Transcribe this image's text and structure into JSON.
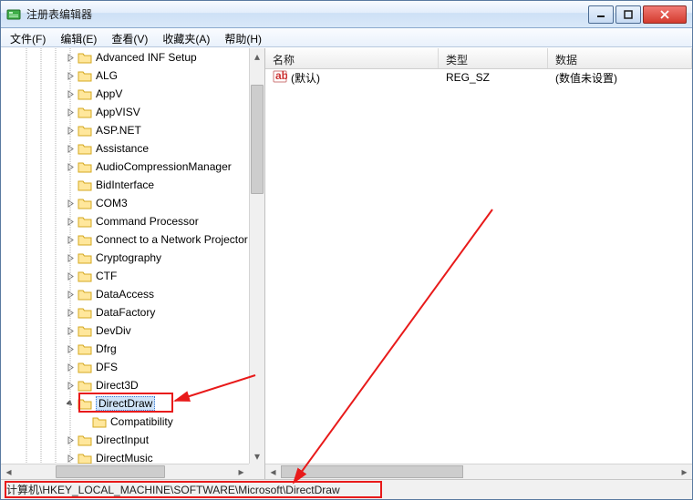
{
  "window": {
    "title": "注册表编辑器"
  },
  "menu": {
    "file": "文件(F)",
    "edit": "编辑(E)",
    "view": "查看(V)",
    "favorites": "收藏夹(A)",
    "help": "帮助(H)"
  },
  "tree": {
    "items": [
      {
        "indent": 4,
        "exp": "closed",
        "label": "Advanced INF Setup"
      },
      {
        "indent": 4,
        "exp": "closed",
        "label": "ALG"
      },
      {
        "indent": 4,
        "exp": "closed",
        "label": "AppV"
      },
      {
        "indent": 4,
        "exp": "closed",
        "label": "AppVISV"
      },
      {
        "indent": 4,
        "exp": "closed",
        "label": "ASP.NET"
      },
      {
        "indent": 4,
        "exp": "closed",
        "label": "Assistance"
      },
      {
        "indent": 4,
        "exp": "closed",
        "label": "AudioCompressionManager"
      },
      {
        "indent": 4,
        "exp": "none",
        "label": "BidInterface"
      },
      {
        "indent": 4,
        "exp": "closed",
        "label": "COM3"
      },
      {
        "indent": 4,
        "exp": "closed",
        "label": "Command Processor"
      },
      {
        "indent": 4,
        "exp": "closed",
        "label": "Connect to a Network Projector"
      },
      {
        "indent": 4,
        "exp": "closed",
        "label": "Cryptography"
      },
      {
        "indent": 4,
        "exp": "closed",
        "label": "CTF"
      },
      {
        "indent": 4,
        "exp": "closed",
        "label": "DataAccess"
      },
      {
        "indent": 4,
        "exp": "closed",
        "label": "DataFactory"
      },
      {
        "indent": 4,
        "exp": "closed",
        "label": "DevDiv"
      },
      {
        "indent": 4,
        "exp": "closed",
        "label": "Dfrg"
      },
      {
        "indent": 4,
        "exp": "closed",
        "label": "DFS"
      },
      {
        "indent": 4,
        "exp": "closed",
        "label": "Direct3D"
      },
      {
        "indent": 4,
        "exp": "open",
        "label": "DirectDraw",
        "selected": true
      },
      {
        "indent": 5,
        "exp": "none",
        "label": "Compatibility"
      },
      {
        "indent": 4,
        "exp": "closed",
        "label": "DirectInput"
      },
      {
        "indent": 4,
        "exp": "closed",
        "label": "DirectMusic"
      }
    ]
  },
  "list": {
    "columns": {
      "name": "名称",
      "type": "类型",
      "data": "数据"
    },
    "rows": [
      {
        "name": "(默认)",
        "type": "REG_SZ",
        "data": "(数值未设置)"
      }
    ]
  },
  "statusbar": {
    "path": "计算机\\HKEY_LOCAL_MACHINE\\SOFTWARE\\Microsoft\\DirectDraw"
  }
}
